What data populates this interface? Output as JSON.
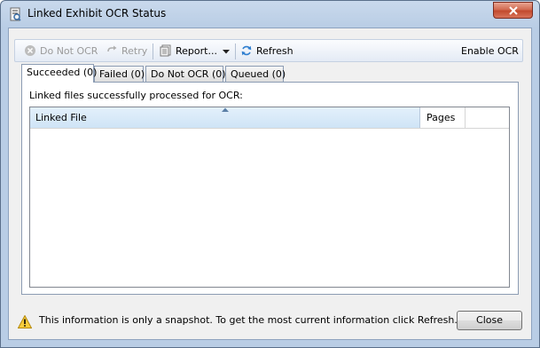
{
  "window": {
    "title": "Linked Exhibit OCR Status",
    "icon": "ocr-app-icon"
  },
  "toolbar": {
    "do_not_ocr": "Do Not OCR",
    "retry": "Retry",
    "report": "Report...",
    "refresh": "Refresh",
    "enable_ocr": "Enable OCR"
  },
  "tabs": [
    {
      "label": "Succeeded (0)",
      "active": true
    },
    {
      "label": "Failed (0)",
      "active": false
    },
    {
      "label": "Do Not OCR (0)",
      "active": false
    },
    {
      "label": "Queued (0)",
      "active": false
    }
  ],
  "panel": {
    "label": "Linked files successfully processed for OCR:"
  },
  "grid": {
    "columns": [
      "Linked File",
      "Pages"
    ],
    "rows": []
  },
  "footer": {
    "message": "This information is only a snapshot.  To get the most current information click Refresh.",
    "close_label": "Close"
  },
  "colors": {
    "title_bar": "#b9cde5",
    "close_red": "#c24a2e",
    "header_highlight": "#d9eaf8"
  }
}
